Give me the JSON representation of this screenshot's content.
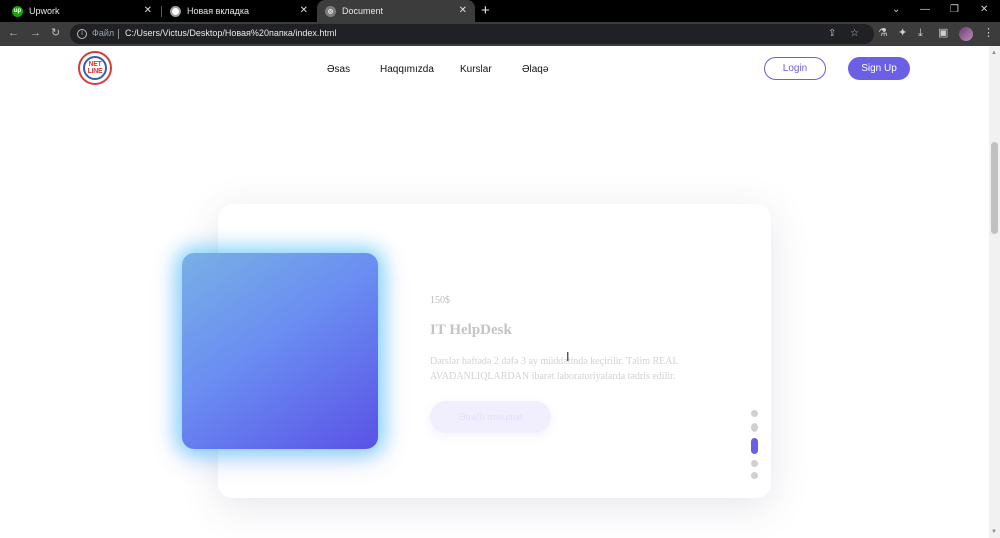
{
  "browser": {
    "tabs": [
      {
        "title": "Upwork",
        "active": false,
        "favicon": "upwork-icon"
      },
      {
        "title": "Новая вкладка",
        "active": false,
        "favicon": "chrome-icon"
      },
      {
        "title": "Document",
        "active": true,
        "favicon": "globe-icon"
      }
    ],
    "address_label": "Файл",
    "url": "C:/Users/Victus/Desktop/Новая%20папка/index.html"
  },
  "site": {
    "logo_text": "NET LINE",
    "nav": [
      "Əsas",
      "Haqqımızda",
      "Kurslar",
      "Əlaqə"
    ],
    "login_label": "Login",
    "signup_label": "Sign Up",
    "accent_color": "#6b5fe6"
  },
  "course_card": {
    "price": "150$",
    "title": "IT HelpDesk",
    "description": "Dərslər həftədə 2 dəfə 3 ay müddətində keçirilir. Təlim REAL AVADANLIQLARDAN ibarət laboratoriyalarda tədris edilir.",
    "button_label": "Ətraflı məlumat",
    "slides_total": 5,
    "slide_active": 3
  }
}
